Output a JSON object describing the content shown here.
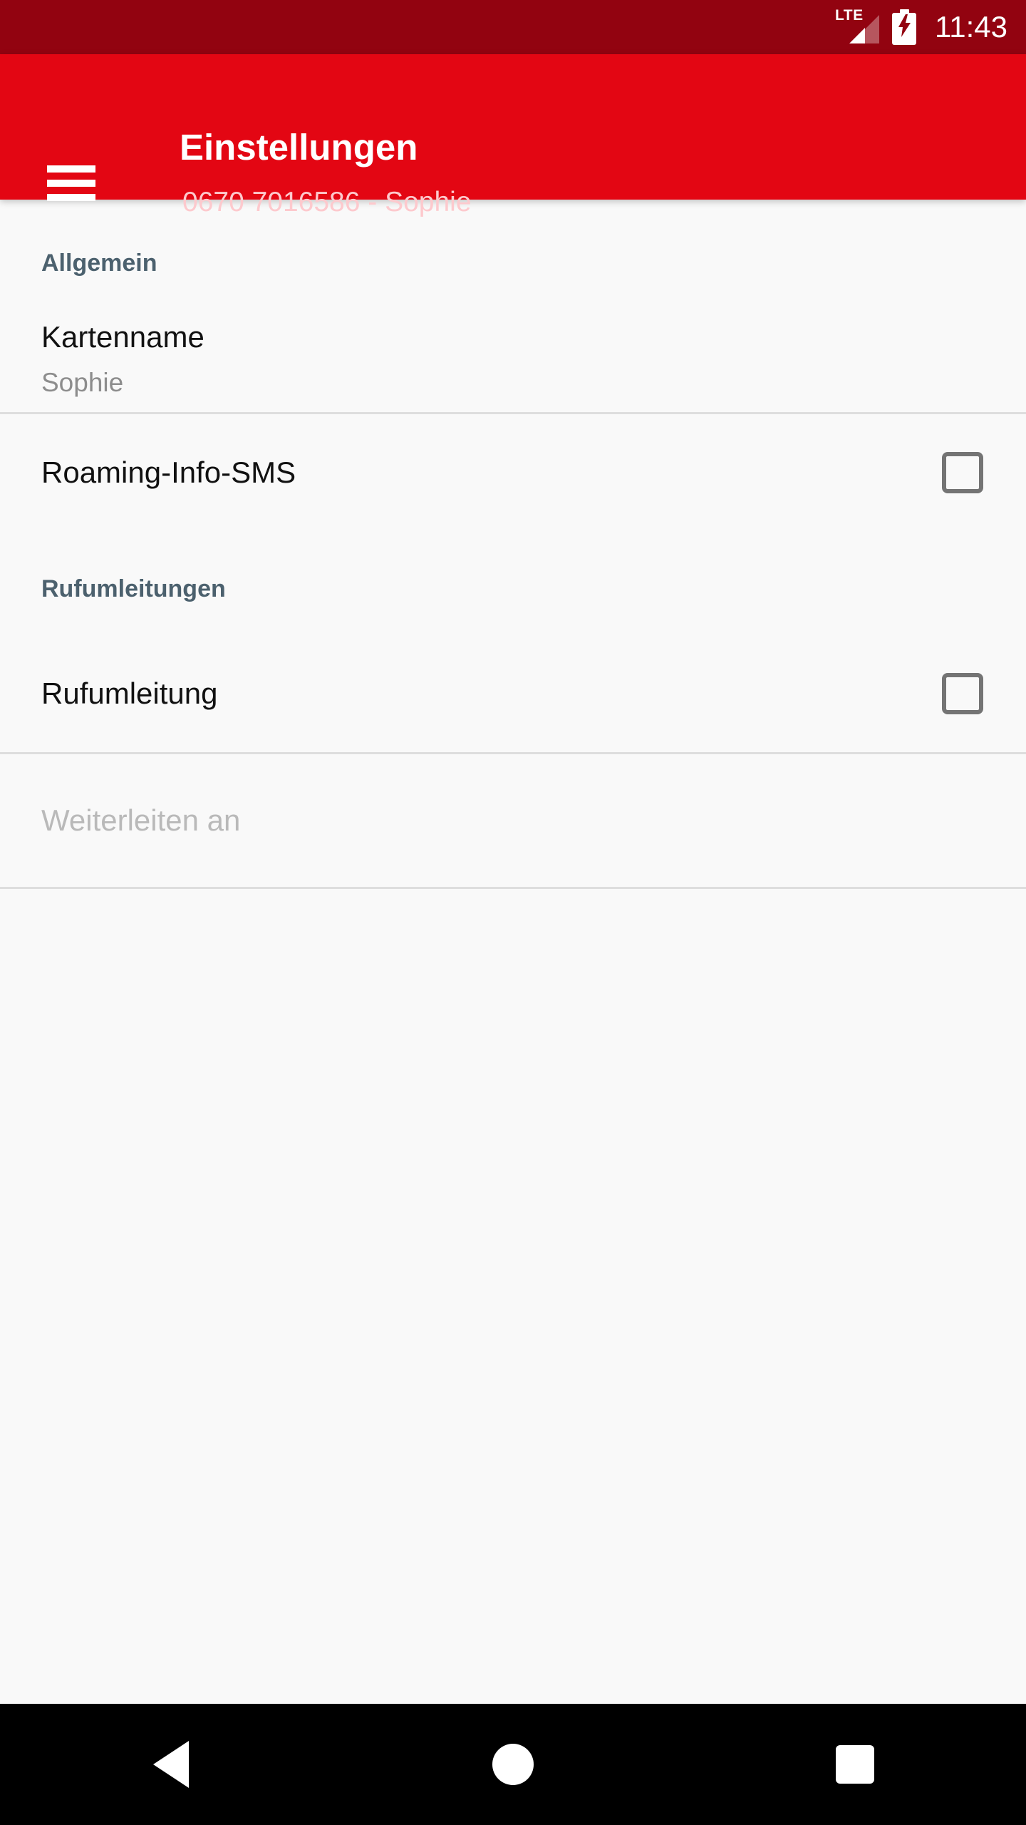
{
  "status_bar": {
    "network_label": "LTE",
    "time": "11:43",
    "signal_icon": "signal-triangle-icon",
    "battery_icon": "battery-charging-icon",
    "background_color": "#920310"
  },
  "app_bar": {
    "menu_icon": "hamburger-menu-icon",
    "title": "Einstellungen",
    "subtitle": "0670 7016586 - Sophie",
    "background_color": "#e30613"
  },
  "sections": {
    "general": {
      "header": "Allgemein",
      "header_color": "#4c616e",
      "rows": [
        {
          "title": "Kartenname",
          "subtitle": "Sophie",
          "type": "value-row"
        },
        {
          "title": "Roaming-Info-SMS",
          "type": "checkbox-row",
          "checked": false,
          "checkbox_icon": "checkbox-unchecked-icon"
        }
      ]
    },
    "forwarding": {
      "header": "Rufumleitungen",
      "header_color": "#4c616e",
      "rows": [
        {
          "title": "Rufumleitung",
          "type": "checkbox-row",
          "checked": false,
          "checkbox_icon": "checkbox-unchecked-icon"
        },
        {
          "title": "",
          "placeholder": "Weiterleiten an",
          "type": "input-row",
          "value": ""
        }
      ]
    }
  },
  "nav_bar": {
    "back_label": "back-triangle-icon",
    "home_label": "home-circle-icon",
    "recents_label": "recents-square-icon",
    "background_color": "#000000"
  }
}
